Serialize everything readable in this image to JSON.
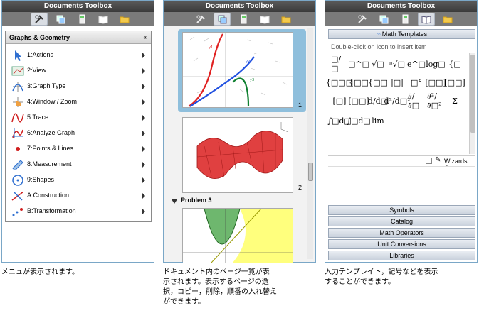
{
  "window_title": "Documents Toolbox",
  "menu": {
    "header": "Graphs & Geometry",
    "collapse_glyph": "«",
    "items": [
      {
        "label": "1:Actions",
        "icon": "pointer-arrow-icon"
      },
      {
        "label": "2:View",
        "icon": "view-icon"
      },
      {
        "label": "3:Graph Type",
        "icon": "graph-type-icon"
      },
      {
        "label": "4:Window / Zoom",
        "icon": "window-zoom-icon"
      },
      {
        "label": "5:Trace",
        "icon": "trace-icon"
      },
      {
        "label": "6:Analyze Graph",
        "icon": "analyze-graph-icon"
      },
      {
        "label": "7:Points & Lines",
        "icon": "points-lines-icon"
      },
      {
        "label": "8:Measurement",
        "icon": "ruler-icon"
      },
      {
        "label": "9:Shapes",
        "icon": "circle-shape-icon"
      },
      {
        "label": "A:Construction",
        "icon": "construction-icon"
      },
      {
        "label": "B:Transformation",
        "icon": "transformation-icon"
      }
    ]
  },
  "sorter": {
    "page_numbers": [
      "1",
      "2"
    ],
    "problem_label": "Problem 3"
  },
  "utilities": {
    "math_templates_label": "Math Templates",
    "hint": "Double-click on icon to insert item",
    "templates": [
      [
        "□/□",
        "□^□",
        "√□",
        "ⁿ√□",
        "e^□",
        "log□",
        "{□"
      ],
      [
        "{□□□",
        "{□□",
        "{□□",
        "|□|",
        "□°",
        "[□□]",
        "[□□]"
      ],
      [
        "[□]",
        "[□□]",
        "d/d□",
        "d²/d□²",
        "∂/∂□",
        "∂²/∂□²",
        "Σ"
      ],
      [
        "∫□d□",
        "∫□d□",
        "lim"
      ]
    ],
    "wizards_label": "Wizards On",
    "sections": [
      "Symbols",
      "Catalog",
      "Math Operators",
      "Unit Conversions",
      "Libraries"
    ]
  },
  "captions": {
    "c1": "メニュが表示されます。",
    "c2": [
      "ドキュメント内のページ一覧が表",
      "示されます。表示するページの選",
      "択，コピー，削除，順番の入れ替え",
      "ができます。"
    ],
    "c3": [
      "入力テンプレイト，記号などを表示",
      "することができます。"
    ]
  },
  "colors": {
    "accent_border": "#7aa7c7",
    "selected_page": "#8fbfdc",
    "titlebar": "#444444"
  }
}
